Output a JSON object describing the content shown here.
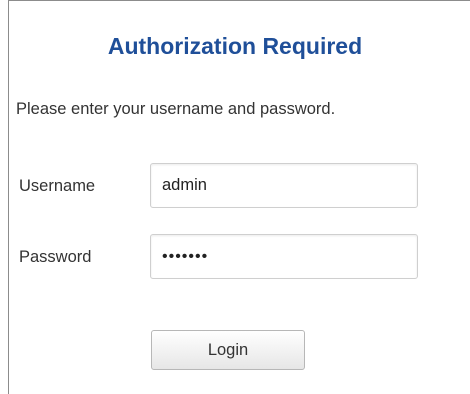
{
  "dialog": {
    "title": "Authorization Required",
    "prompt": "Please enter your username and password."
  },
  "form": {
    "username_label": "Username",
    "username_value": "admin",
    "password_label": "Password",
    "password_value": "1234567",
    "login_label": "Login"
  },
  "colors": {
    "title": "#1f4f99",
    "text": "#333333",
    "input_border": "#cfcfcf"
  }
}
